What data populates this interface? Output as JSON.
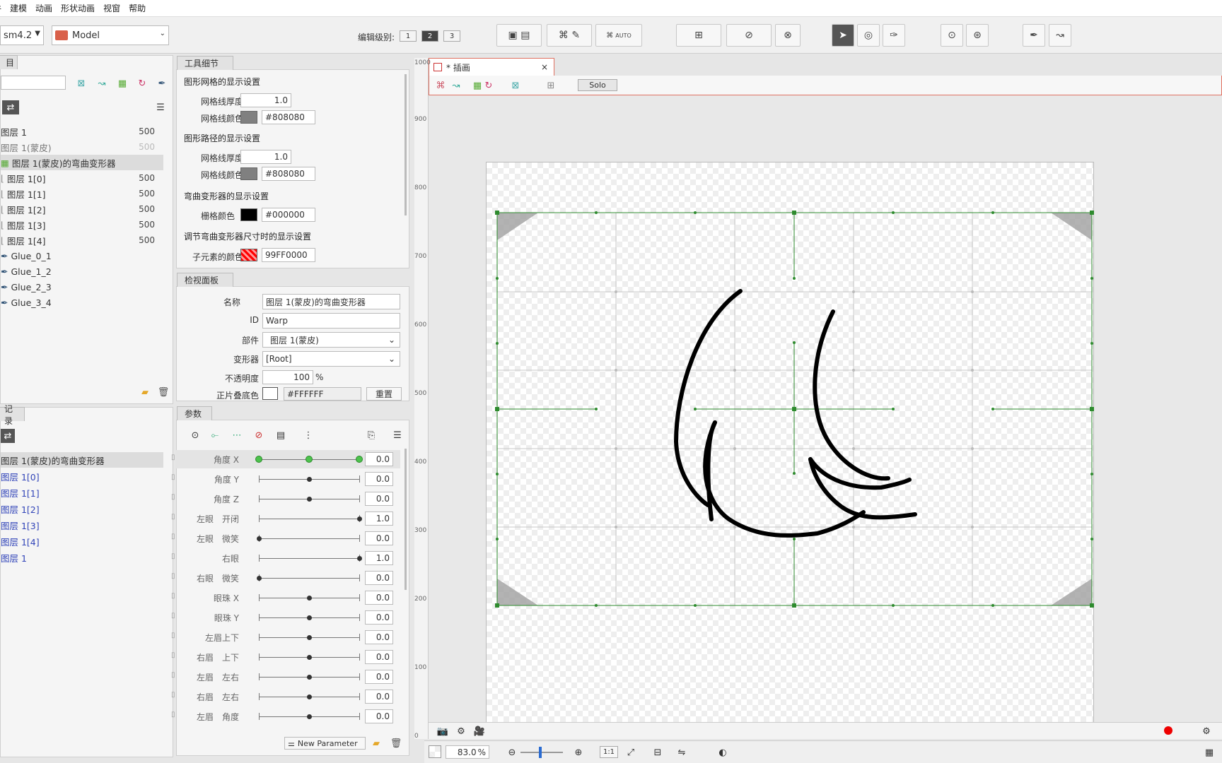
{
  "menu": [
    "文件",
    "建模",
    "动画",
    "形状动画",
    "视窗",
    "帮助"
  ],
  "toolbar": {
    "version_combo": "sm4.2",
    "model_combo": "Model",
    "edit_level_label": "编辑级别:",
    "levels": [
      "1",
      "2",
      "3"
    ],
    "selected_level": "2",
    "auto_label": "AUTO"
  },
  "left_panel": {
    "tab_label": "目",
    "items": [
      {
        "label": "图层 1",
        "value": "500"
      },
      {
        "label": "图层 1(蒙皮)",
        "value": "500"
      },
      {
        "label": "图层 1(蒙皮)的弯曲变形器",
        "value": ""
      },
      {
        "label": "图层 1[0]",
        "value": "500"
      },
      {
        "label": "图层 1[1]",
        "value": "500"
      },
      {
        "label": "图层 1[2]",
        "value": "500"
      },
      {
        "label": "图层 1[3]",
        "value": "500"
      },
      {
        "label": "图层 1[4]",
        "value": "500"
      },
      {
        "label": "Glue_0_1",
        "value": ""
      },
      {
        "label": "Glue_1_2",
        "value": ""
      },
      {
        "label": "Glue_2_3",
        "value": ""
      },
      {
        "label": "Glue_3_4",
        "value": ""
      }
    ]
  },
  "record_panel": {
    "tab_label": "记录",
    "items": [
      "图层 1(蒙皮)的弯曲变形器",
      "图层 1[0]",
      "图层 1[1]",
      "图层 1[2]",
      "图层 1[3]",
      "图层 1[4]",
      "图层 1"
    ]
  },
  "tool_details": {
    "tab_label": "工具细节",
    "mesh_display_title": "图形网格的显示设置",
    "mesh_thickness_label": "网格线厚度",
    "mesh_thickness": "1.0",
    "mesh_color_label": "网格线颜色",
    "mesh_color": "#808080",
    "path_display_title": "图形路径的显示设置",
    "path_thickness_label": "网格线厚度",
    "path_thickness": "1.0",
    "path_color_label": "网格线颜色",
    "path_color": "#808080",
    "warp_display_title": "弯曲变形器的显示设置",
    "grid_color_label": "栅格颜色",
    "grid_color": "#000000",
    "resize_display_title": "调节弯曲变形器尺寸时的显示设置",
    "child_color_label": "子元素的颜色",
    "child_color": "99FF0000"
  },
  "inspector": {
    "tab_label": "检视面板",
    "name_label": "名称",
    "name_value": "图层 1(蒙皮)的弯曲变形器",
    "id_label": "ID",
    "id_value": "Warp",
    "part_label": "部件",
    "part_value": "图层 1(蒙皮)",
    "deformer_label": "变形器",
    "deformer_value": "[Root]",
    "opacity_label": "不透明度",
    "opacity_value": "100",
    "opacity_unit": "%",
    "multiply_label": "正片叠底色",
    "multiply_value": "#FFFFFF",
    "reset_label": "重置"
  },
  "params": {
    "tab_label": "参数",
    "new_parameter_label": "New Parameter",
    "rows": [
      {
        "name": "角度 X",
        "value": "0.0",
        "pos": 0.5
      },
      {
        "name": "角度 Y",
        "value": "0.0",
        "pos": 0.5
      },
      {
        "name": "角度 Z",
        "value": "0.0",
        "pos": 0.5
      },
      {
        "name": "左眼　开闭",
        "value": "1.0",
        "pos": 1.0
      },
      {
        "name": "左眼　微笑",
        "value": "0.0",
        "pos": 0.0
      },
      {
        "name": "右眼",
        "value": "1.0",
        "pos": 1.0
      },
      {
        "name": "右眼　微笑",
        "value": "0.0",
        "pos": 0.0
      },
      {
        "name": "眼珠 X",
        "value": "0.0",
        "pos": 0.5
      },
      {
        "name": "眼珠 Y",
        "value": "0.0",
        "pos": 0.5
      },
      {
        "name": "左眉上下",
        "value": "0.0",
        "pos": 0.5
      },
      {
        "name": "右眉　上下",
        "value": "0.0",
        "pos": 0.5
      },
      {
        "name": "左眉　左右",
        "value": "0.0",
        "pos": 0.5
      },
      {
        "name": "右眉　左右",
        "value": "0.0",
        "pos": 0.5
      },
      {
        "name": "左眉　角度",
        "value": "0.0",
        "pos": 0.5
      }
    ]
  },
  "viewport": {
    "tab_title": "* 插画",
    "solo_label": "Solo",
    "ruler_labels": [
      "1000",
      "900",
      "800",
      "700",
      "600",
      "500",
      "400",
      "300",
      "200",
      "100",
      "0"
    ],
    "zoom": "83.0",
    "zoom_unit": "%",
    "ratio_label": "1:1"
  }
}
